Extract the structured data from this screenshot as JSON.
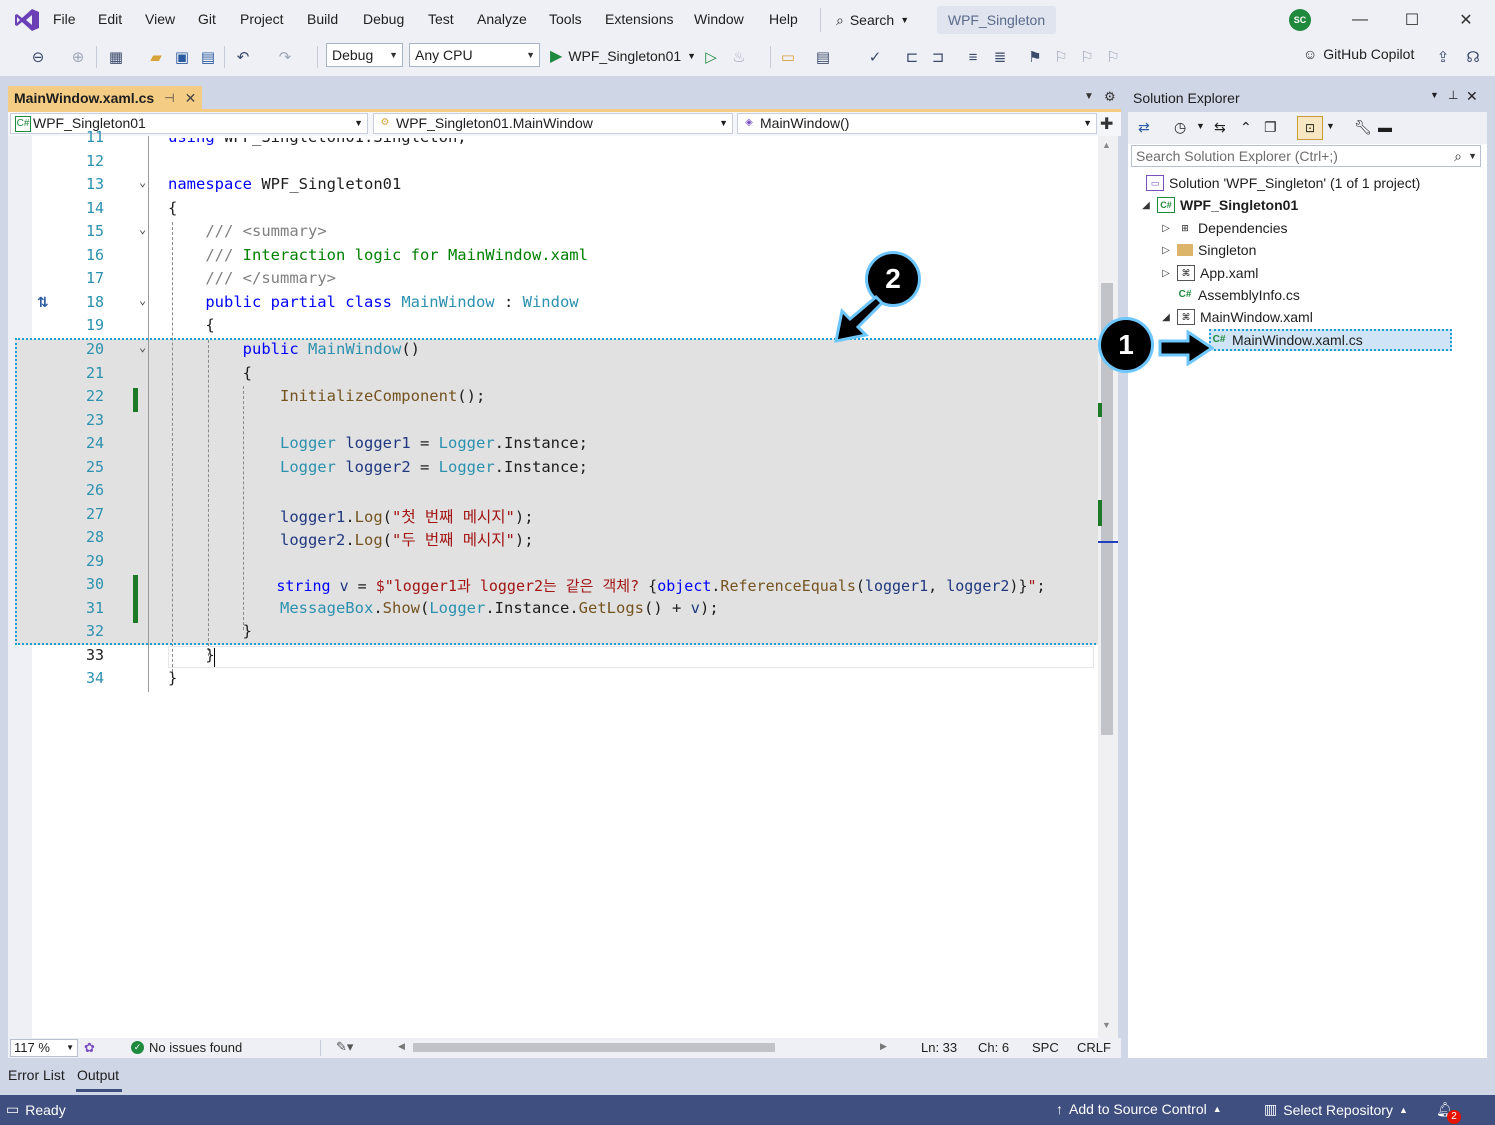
{
  "menu": {
    "items": [
      "File",
      "Edit",
      "View",
      "Git",
      "Project",
      "Build",
      "Debug",
      "Test",
      "Analyze",
      "Tools",
      "Extensions",
      "Window",
      "Help"
    ],
    "search_label": "Search",
    "solution_name": "WPF_Singleton",
    "avatar_initials": "SC"
  },
  "toolbar": {
    "config": "Debug",
    "platform": "Any CPU",
    "run_target": "WPF_Singleton01",
    "copilot_label": "GitHub Copilot"
  },
  "document": {
    "tab_title": "MainWindow.xaml.cs",
    "nav_project": "WPF_Singleton01",
    "nav_class": "WPF_Singleton01.MainWindow",
    "nav_member": "MainWindow()"
  },
  "editor": {
    "lines": [
      {
        "n": "11",
        "code": "using WPF_Singleton01.Singleton;"
      },
      {
        "n": "12",
        "code": ""
      },
      {
        "n": "13",
        "code": "namespace WPF_Singleton01"
      },
      {
        "n": "14",
        "code": "{"
      },
      {
        "n": "15",
        "code": "    /// <summary>"
      },
      {
        "n": "16",
        "code": "    /// Interaction logic for MainWindow.xaml"
      },
      {
        "n": "17",
        "code": "    /// </summary>"
      },
      {
        "n": "18",
        "code": "    public partial class MainWindow : Window"
      },
      {
        "n": "19",
        "code": "    {"
      },
      {
        "n": "20",
        "code": "        public MainWindow()"
      },
      {
        "n": "21",
        "code": "        {"
      },
      {
        "n": "22",
        "code": "            InitializeComponent();"
      },
      {
        "n": "23",
        "code": ""
      },
      {
        "n": "24",
        "code": "            Logger logger1 = Logger.Instance;"
      },
      {
        "n": "25",
        "code": "            Logger logger2 = Logger.Instance;"
      },
      {
        "n": "26",
        "code": ""
      },
      {
        "n": "27",
        "code": "            logger1.Log(\"첫 번째 메시지\");"
      },
      {
        "n": "28",
        "code": "            logger2.Log(\"두 번째 메시지\");"
      },
      {
        "n": "29",
        "code": ""
      },
      {
        "n": "30",
        "code": "            string v = $\"logger1과 logger2는 같은 객체? {object.ReferenceEquals(logger1, logger2)}\";"
      },
      {
        "n": "31",
        "code": "            MessageBox.Show(Logger.Instance.GetLogs() + v);"
      },
      {
        "n": "32",
        "code": "        }"
      },
      {
        "n": "33",
        "code": "    }"
      },
      {
        "n": "34",
        "code": "}"
      }
    ]
  },
  "editor_status": {
    "zoom": "117 %",
    "issues": "No issues found",
    "line": "Ln: 33",
    "col": "Ch: 6",
    "spacing": "SPC",
    "eol": "CRLF"
  },
  "bottom_tabs": [
    "Error List",
    "Output"
  ],
  "statusbar": {
    "ready": "Ready",
    "source_control": "Add to Source Control",
    "repo": "Select Repository",
    "notif_count": "2"
  },
  "solution_explorer": {
    "title": "Solution Explorer",
    "search_placeholder": "Search Solution Explorer (Ctrl+;)",
    "solution_label": "Solution 'WPF_Singleton' (1 of 1 project)",
    "project": "WPF_Singleton01",
    "items": [
      "Dependencies",
      "Singleton",
      "App.xaml",
      "AssemblyInfo.cs",
      "MainWindow.xaml",
      "MainWindow.xaml.cs"
    ]
  },
  "annotations": {
    "one": "1",
    "two": "2"
  },
  "colors": {
    "accent": "#f5cc84",
    "statusbar": "#3f4f80",
    "keyword": "#0000ff",
    "type": "#2b91af",
    "comment": "#008000",
    "string": "#a31515"
  }
}
